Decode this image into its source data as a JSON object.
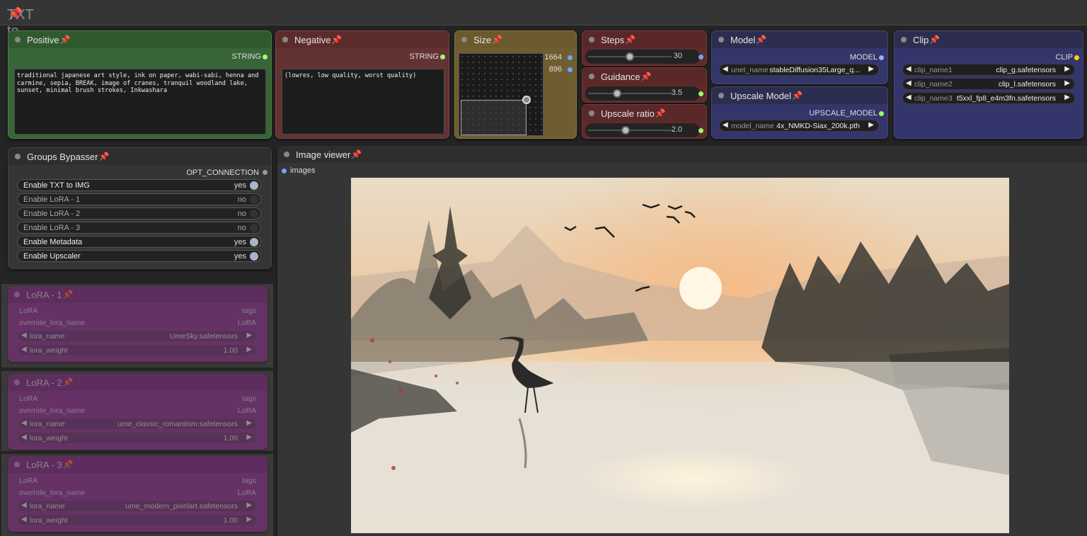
{
  "group": {
    "title": "TXT to IMG",
    "pin": "📌"
  },
  "colors": {
    "positive_header": "#2f5a2f",
    "negative_header": "#5c2c2c",
    "size_header": "#6a5a2d",
    "param_header": "#5a2828",
    "model_header": "#2d2e4f",
    "lora_body": "#8a2d8b",
    "port_string": "#9cff66",
    "port_model": "#8fb3ff",
    "port_clip": "#ffd500"
  },
  "positive": {
    "title": "Positive",
    "output": "STRING",
    "text": "traditional japanese art style, ink on paper, wabi-sabi, henna and carmine, sepia, BREAK, image of cranes, tranquil woodland lake, sunset, minimal brush strokes, Inkwashara"
  },
  "negative": {
    "title": "Negative",
    "output": "STRING",
    "text": "(lowres, low quality, worst quality)"
  },
  "size": {
    "title": "Size",
    "width": "1664",
    "height": "896"
  },
  "steps": {
    "title": "Steps",
    "value": "30",
    "fraction": 0.5
  },
  "guidance": {
    "title": "Guidance",
    "value": "3.5",
    "fraction": 0.35
  },
  "upscale_ratio": {
    "title": "Upscale ratio",
    "value": "2.0",
    "fraction": 0.45
  },
  "model": {
    "title": "Model",
    "output": "MODEL",
    "unet_label": "unet_name",
    "unet_value": "stableDiffusion35Large_q..."
  },
  "upscale_model": {
    "title": "Upscale Model",
    "output": "UPSCALE_MODEL",
    "model_label": "model_name",
    "model_value": "4x_NMKD-Siax_200k.pth"
  },
  "clip": {
    "title": "Clip",
    "output": "CLIP",
    "items": [
      {
        "label": "clip_name1",
        "value": "clip_g.safetensors"
      },
      {
        "label": "clip_name2",
        "value": "clip_l.safetensors"
      },
      {
        "label": "clip_name3",
        "value": "t5xxl_fp8_e4m3fn.safetensors"
      }
    ]
  },
  "bypasser": {
    "title": "Groups Bypasser",
    "output": "OPT_CONNECTION",
    "toggles": [
      {
        "label": "Enable TXT to IMG",
        "value": "yes",
        "on": true
      },
      {
        "label": "Enable LoRA - 1",
        "value": "no",
        "on": false
      },
      {
        "label": "Enable LoRA - 2",
        "value": "no",
        "on": false
      },
      {
        "label": "Enable LoRA - 3",
        "value": "no",
        "on": false
      },
      {
        "label": "Enable Metadata",
        "value": "yes",
        "on": true
      },
      {
        "label": "Enable Upscaler",
        "value": "yes",
        "on": true
      }
    ]
  },
  "loras": [
    {
      "title": "LoRA - 1",
      "in_label": "LoRA",
      "out_tags": "tags",
      "override": "override_lora_name",
      "out_lora": "LoRA",
      "name_label": "lora_name",
      "name_value": "UmeSky.safetensors",
      "weight_label": "lora_weight",
      "weight_value": "1.00"
    },
    {
      "title": "LoRA - 2",
      "in_label": "LoRA",
      "out_tags": "tags",
      "override": "override_lora_name",
      "out_lora": "LoRA",
      "name_label": "lora_name",
      "name_value": "ume_classic_romantism.safetensors",
      "weight_label": "lora_weight",
      "weight_value": "1.00"
    },
    {
      "title": "LoRA - 3",
      "in_label": "LoRA",
      "out_tags": "tags",
      "override": "override_lora_name",
      "out_lora": "LoRA",
      "name_label": "lora_name",
      "name_value": "ume_modern_pixelart.safetensors",
      "weight_label": "lora_weight",
      "weight_value": "1.00"
    }
  ],
  "viewer": {
    "title": "Image viewer",
    "input": "images"
  },
  "icons": {
    "pin": "pushpin-icon",
    "dot": "node-collapse-dot-icon",
    "left": "arrow-left-icon",
    "right": "arrow-right-icon"
  }
}
